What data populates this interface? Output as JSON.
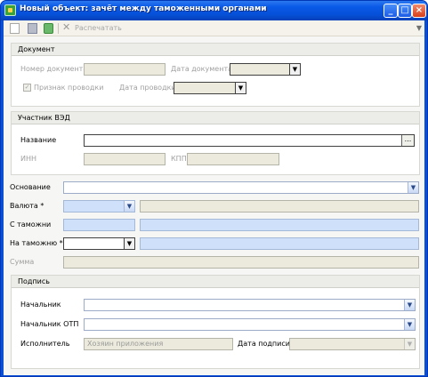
{
  "window": {
    "title": "Новый объект: зачёт между таможенными органами",
    "min": "_",
    "max": "□",
    "close": "×"
  },
  "toolbar": {
    "print_label": "Распечатать",
    "delete_glyph": "✕",
    "overflow_glyph": "▼"
  },
  "document_group": {
    "header": "Документ",
    "doc_number_label": "Номер документа",
    "doc_number_value": "",
    "doc_date_label": "Дата документа",
    "posting_flag_label": "Признак проводки",
    "posting_flag_mark": "✓",
    "posting_date_label": "Дата проводки"
  },
  "participant_group": {
    "header": "Участник ВЭД",
    "name_label": "Название",
    "name_value": "",
    "ellipsis": "...",
    "inn_label": "ИНН",
    "kpp_label": "КПП"
  },
  "main_fields": {
    "basis_label": "Основание",
    "currency_label": "Валюта *",
    "from_customs_label": "С таможни",
    "to_customs_label": "На таможню *",
    "amount_label": "Сумма"
  },
  "signature_group": {
    "header": "Подпись",
    "chief_label": "Начальник",
    "chief_otp_label": "Начальник ОТП",
    "executor_label": "Исполнитель",
    "executor_value": "Хозяин приложения",
    "sign_date_label": "Дата подписи"
  },
  "dropdown_glyph": "▼",
  "colors": {
    "titlebar": "#0a5ae8",
    "required_fill": "#cfe0fa",
    "disabled_fill": "#eceadc"
  }
}
